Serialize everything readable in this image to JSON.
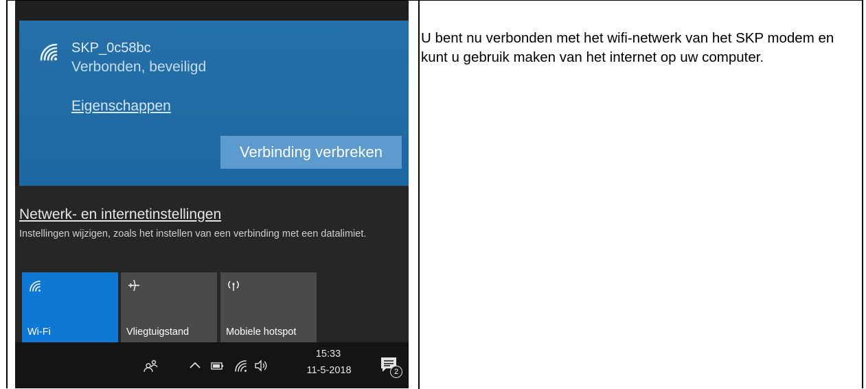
{
  "screenshot": {
    "network": {
      "ssid": "SKP_0c58bc",
      "status": "Verbonden, beveiligd",
      "properties_link": "Eigenschappen",
      "disconnect_button": "Verbinding verbreken"
    },
    "settings": {
      "title": "Netwerk- en internetinstellingen",
      "description": "Instellingen wijzigen, zoals het instellen van een verbinding met een datalimiet."
    },
    "tiles": [
      {
        "label": "Wi-Fi",
        "icon": "wifi-icon",
        "active": true
      },
      {
        "label": "Vliegtuigstand",
        "icon": "airplane-icon",
        "active": false
      },
      {
        "label": "Mobiele hotspot",
        "icon": "hotspot-icon",
        "active": false
      }
    ],
    "taskbar": {
      "time": "15:33",
      "date": "11-5-2018",
      "notification_count": "2"
    },
    "colors": {
      "panel_blue": "#1e6aa4",
      "tile_active": "#0e78d4",
      "tile_inactive": "#4a4a4a"
    }
  },
  "instruction_text": "U bent nu verbonden met het wifi-netwerk van het SKP modem en kunt u gebruik maken van het internet op uw computer."
}
